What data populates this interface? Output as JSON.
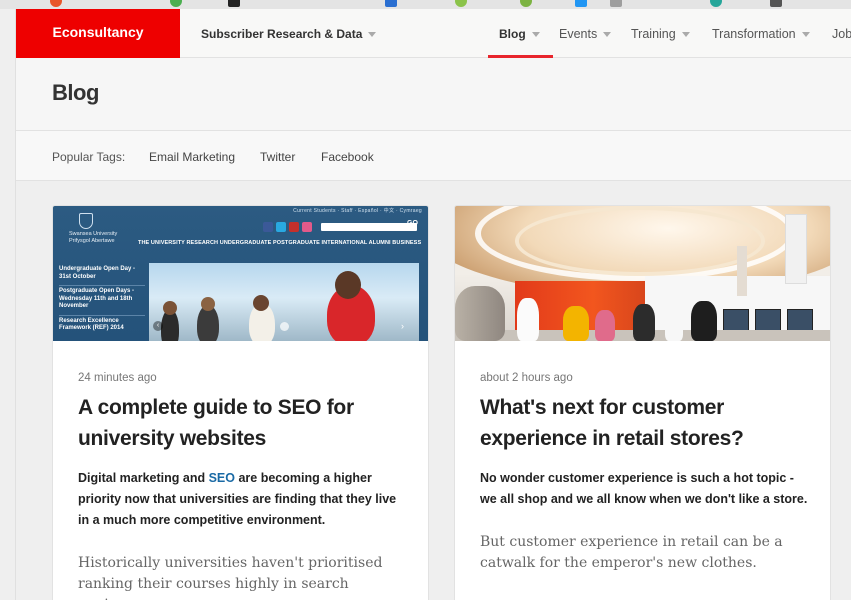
{
  "nav": {
    "logo": "Econsultancy",
    "items": [
      {
        "label": "Subscriber Research & Data"
      },
      {
        "label": "Blog"
      },
      {
        "label": "Events"
      },
      {
        "label": "Training"
      },
      {
        "label": "Transformation"
      },
      {
        "label": "Job"
      }
    ],
    "active": "Blog"
  },
  "blog": {
    "title": "Blog"
  },
  "tags": {
    "label": "Popular Tags:",
    "items": [
      "Email Marketing",
      "Twitter",
      "Facebook"
    ]
  },
  "cards": [
    {
      "time": "24 minutes ago",
      "title": "A complete guide to SEO for university websites",
      "lead_1": "Digital marketing and ",
      "lead_link": "SEO",
      "lead_2": " are becoming a higher priority now that universities are finding that they live in a much more competitive environment.",
      "body": "Historically universities haven't prioritised ranking their courses highly in search engines.",
      "image": {
        "uni_name_1": "Swansea University",
        "uni_name_2": "Prifysgol Abertawe",
        "top_links": "Current Students · Staff · Español · 中文 · Cymraeg",
        "search_button": "GO",
        "menu": "THE UNIVERSITY  RESEARCH  UNDERGRADUATE  POSTGRADUATE  INTERNATIONAL  ALUMNI  BUSINESS",
        "side_1": "Undergraduate Open Day - 31st October",
        "side_2": "Postgraduate Open Days - Wednesday 11th and 18th November",
        "side_3": "Research Excellence Framework (REF) 2014",
        "arrow_left": "‹",
        "arrow_right": "›"
      }
    },
    {
      "time": "about 2 hours ago",
      "title": "What's next for customer experience in retail stores?",
      "lead": "No wonder customer experience is such a hot topic - we all shop and we all know when we don't like a store.",
      "body": "But customer experience in retail can be a catwalk for the emperor's new clothes."
    }
  ],
  "colors": {
    "brand_red": "#ee0000",
    "active_underline": "#e8252c",
    "link_blue": "#1a6aa5"
  }
}
